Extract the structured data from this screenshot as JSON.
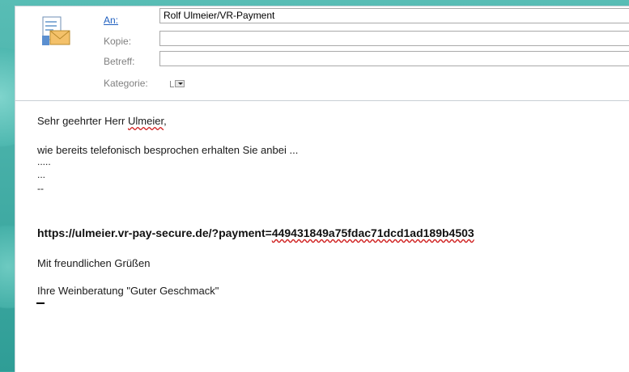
{
  "email": {
    "fields": {
      "to_label": "An:",
      "to_value": "Rolf Ulmeier/VR-Payment",
      "cc_label": "Kopie:",
      "cc_value": "",
      "subject_label": "Betreff:",
      "subject_value": "",
      "category_label": "Kategorie:"
    },
    "body": {
      "greeting_prefix": "Sehr geehrter Herr ",
      "greeting_name": "Ulmeier",
      "greeting_suffix": ",",
      "intro": "wie bereits telefonisch besprochen erhalten Sie anbei ...",
      "placeholder_1": ".....",
      "placeholder_2": "...",
      "placeholder_3": "--",
      "link_base": "https://ulmeier.vr-pay-secure.de/?payment=",
      "link_token": "449431849a75fdac71dcd1ad189b4503",
      "closing": "Mit freundlichen Grüßen",
      "signature": "Ihre Weinberatung \"Guter Geschmack\""
    }
  },
  "colors": {
    "background": "#3aa7a0",
    "link_label": "#1f5fbf",
    "label_gray": "#808080",
    "spellcheck": "#d02020"
  },
  "icons": {
    "send": "envelope-document-icon"
  }
}
